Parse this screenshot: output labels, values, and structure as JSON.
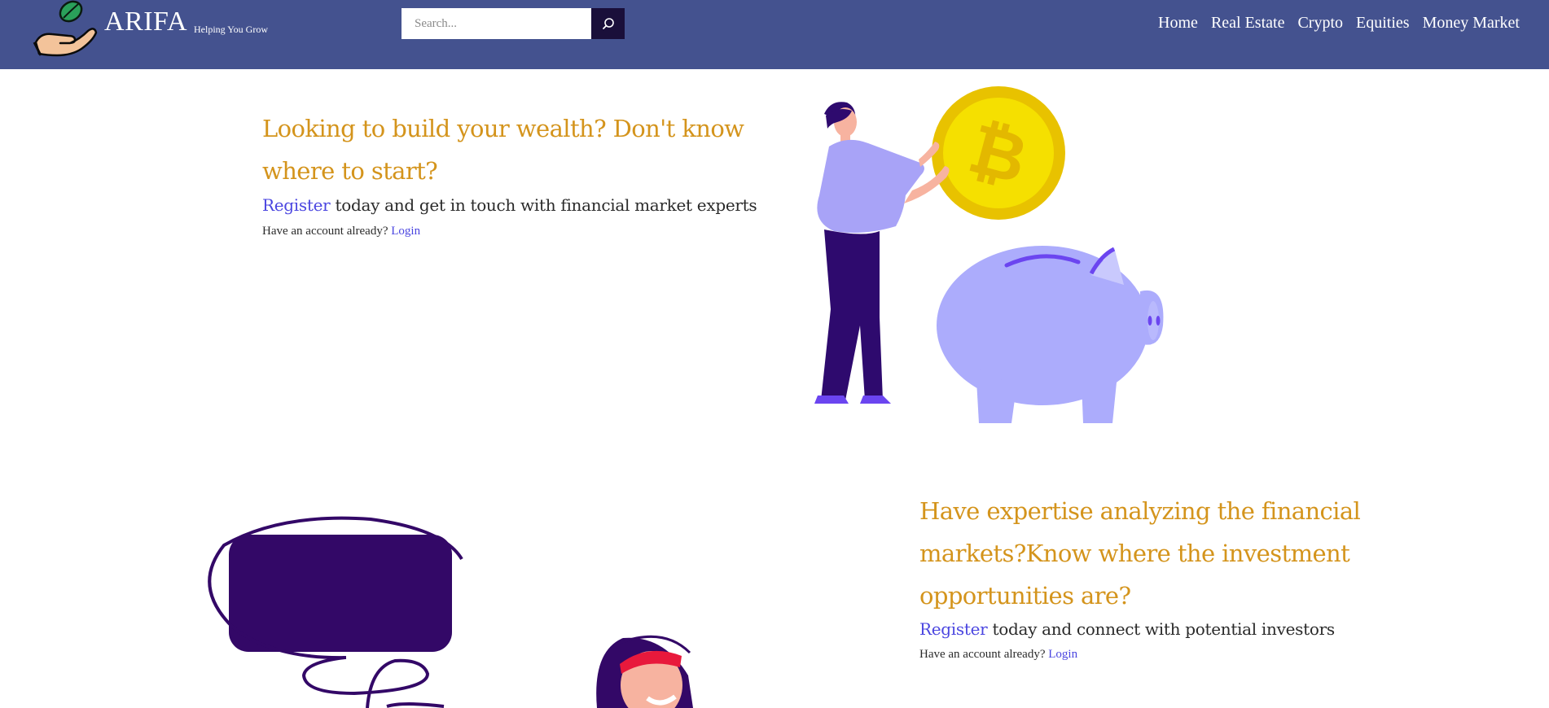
{
  "brand": {
    "name": "ARIFA",
    "tagline": "Helping You Grow"
  },
  "search": {
    "placeholder": "Search...",
    "value": ""
  },
  "nav": {
    "items": [
      "Home",
      "Real Estate",
      "Crypto",
      "Equities",
      "Money Market"
    ]
  },
  "section_investors": {
    "heading": "Looking to build your wealth? Don't know where to start?",
    "register_link": "Register",
    "lead_rest": " today and get in touch with financial market experts",
    "account_prompt": "Have an account already? ",
    "login_link": "Login"
  },
  "section_experts": {
    "heading": "Have expertise analyzing the financial markets?Know where the investment opportunities are?",
    "register_link": "Register",
    "lead_rest": " today and connect with potential investors",
    "account_prompt": "Have an account already? ",
    "login_link": "Login"
  },
  "colors": {
    "header_bg": "#44528f",
    "heading": "#d4941c",
    "link": "#4b46e0",
    "search_button": "#1a0f3a"
  },
  "icons": {
    "logo": "hand-with-leaf-icon",
    "search": "search-icon"
  }
}
